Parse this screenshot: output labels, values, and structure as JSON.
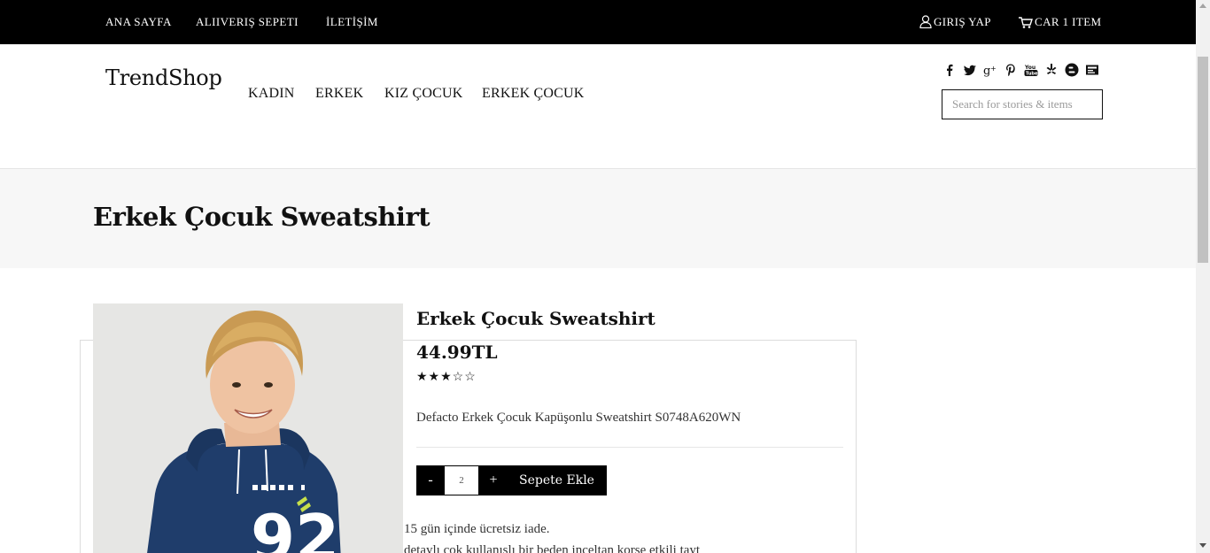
{
  "topbar": {
    "links": [
      {
        "label": "ANA SAYFA"
      },
      {
        "label": "ALIIVERIŞ SEPETI"
      },
      {
        "label": "İLETİŞİM"
      }
    ],
    "login_label": "GIRIŞ YAP",
    "cart_label": "CAR 1 ITEM"
  },
  "header": {
    "logo": "TrendShop",
    "nav": [
      {
        "label": "KADIN"
      },
      {
        "label": "ERKEK"
      },
      {
        "label": "KIZ ÇOCUK"
      },
      {
        "label": "ERKEK ÇOCUK"
      }
    ],
    "social_icons": [
      "facebook-icon",
      "twitter-icon",
      "google-plus-icon",
      "pinterest-icon",
      "youtube-icon",
      "yelp-icon",
      "blogger-icon",
      "email-icon"
    ],
    "search_placeholder": "Search for stories & items"
  },
  "page": {
    "title": "Erkek Çocuk Sweatshirt"
  },
  "product": {
    "title": "Erkek Çocuk Sweatshirt",
    "price": "44.99TL",
    "rating": 3,
    "rating_max": 5,
    "stars_text": "★★★☆☆",
    "description": "Defacto Erkek Çocuk Kapüşonlu Sweatshirt S0748A620WN",
    "quantity": "2",
    "minus_label": "-",
    "plus_label": "+",
    "add_to_cart_label": "Sepete Ekle",
    "image_number": "92",
    "note_return": "15 gün içinde ücretsiz iade.",
    "note_detail": "detaylı çok kullanışlı bir beden inceltan korse etkili tayt"
  },
  "colors": {
    "topbar_bg": "#000000",
    "title_band_bg": "#f7f7f7",
    "button_bg": "#000000",
    "hoodie": "#1f3d6b"
  }
}
